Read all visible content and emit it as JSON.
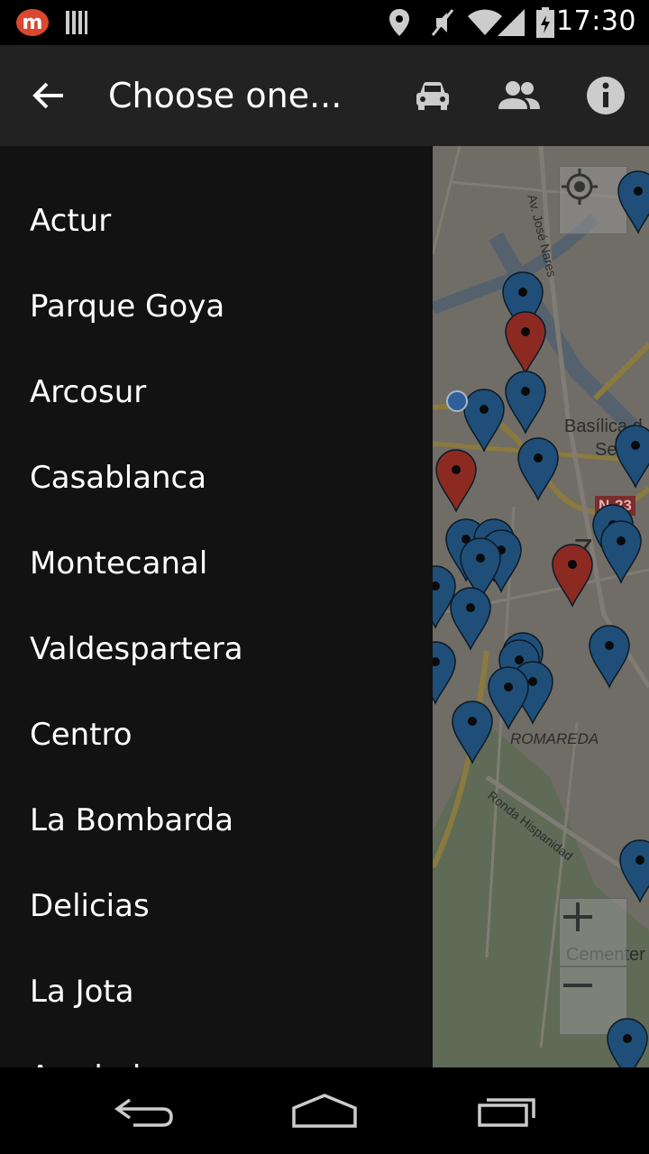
{
  "status_bar": {
    "time": "17:30",
    "icons": [
      "app-notification-icon",
      "barcode-icon",
      "location-icon",
      "mute-icon",
      "wifi-icon",
      "signal-icon",
      "battery-icon"
    ]
  },
  "app_bar": {
    "title": "Choose one...",
    "back_icon": "arrow-left-icon",
    "actions": [
      "car-icon",
      "people-icon",
      "info-icon"
    ]
  },
  "drawer": {
    "items": [
      "Actur",
      "Parque Goya",
      "Arcosur",
      "Casablanca",
      "Montecanal",
      "Valdespartera",
      "Centro",
      "La Bombarda",
      "Delicias",
      "La Jota",
      "Arrabal"
    ]
  },
  "map": {
    "labels": {
      "street_1": "Av. José Nares",
      "basilica_1": "Basílica d",
      "basilica_2": "Señ",
      "road_badge": "N-23",
      "city": "Z",
      "district": "ROMAREDA",
      "street_2": "Ronda Hispanidad",
      "cemetery": "Cementer"
    },
    "controls": [
      "my-location-icon",
      "zoom-in-icon",
      "zoom-out-icon"
    ],
    "colors": {
      "marker_blue": "#1f4f78",
      "marker_red": "#8c2a22"
    }
  },
  "nav_bar": {
    "buttons": [
      "back-icon",
      "home-icon",
      "recents-icon"
    ]
  }
}
